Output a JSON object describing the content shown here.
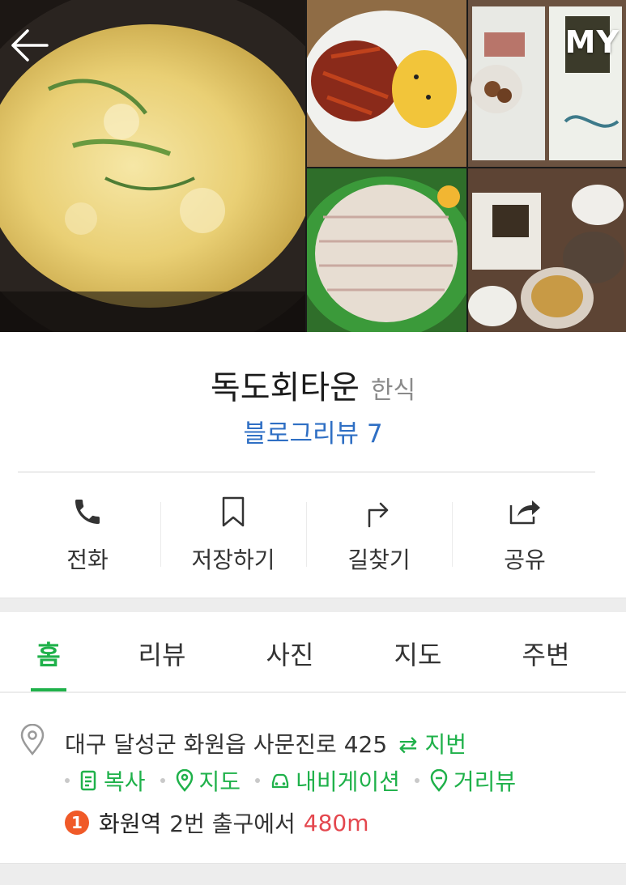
{
  "header": {
    "my_label": "MY"
  },
  "place": {
    "name": "독도회타운",
    "category": "한식",
    "blog_review": "블로그리뷰 7"
  },
  "actions": [
    {
      "label": "전화"
    },
    {
      "label": "저장하기"
    },
    {
      "label": "길찾기"
    },
    {
      "label": "공유"
    }
  ],
  "tabs": [
    {
      "label": "홈"
    },
    {
      "label": "리뷰"
    },
    {
      "label": "사진"
    },
    {
      "label": "지도"
    },
    {
      "label": "주변"
    }
  ],
  "address": {
    "road": "대구 달성군 화원읍 사문진로 425",
    "jibun": "⇄ 지번",
    "links": [
      {
        "label": "복사"
      },
      {
        "label": "지도"
      },
      {
        "label": "내비게이션"
      },
      {
        "label": "거리뷰"
      }
    ],
    "station_number": "1",
    "station": "화원역",
    "exit_text": "2번 출구에서",
    "distance": "480m"
  },
  "colors": {
    "accent": "#1fb14a",
    "link_blue": "#2f6fc4",
    "distance_red": "#e4474e",
    "station_badge": "#f05a28"
  }
}
